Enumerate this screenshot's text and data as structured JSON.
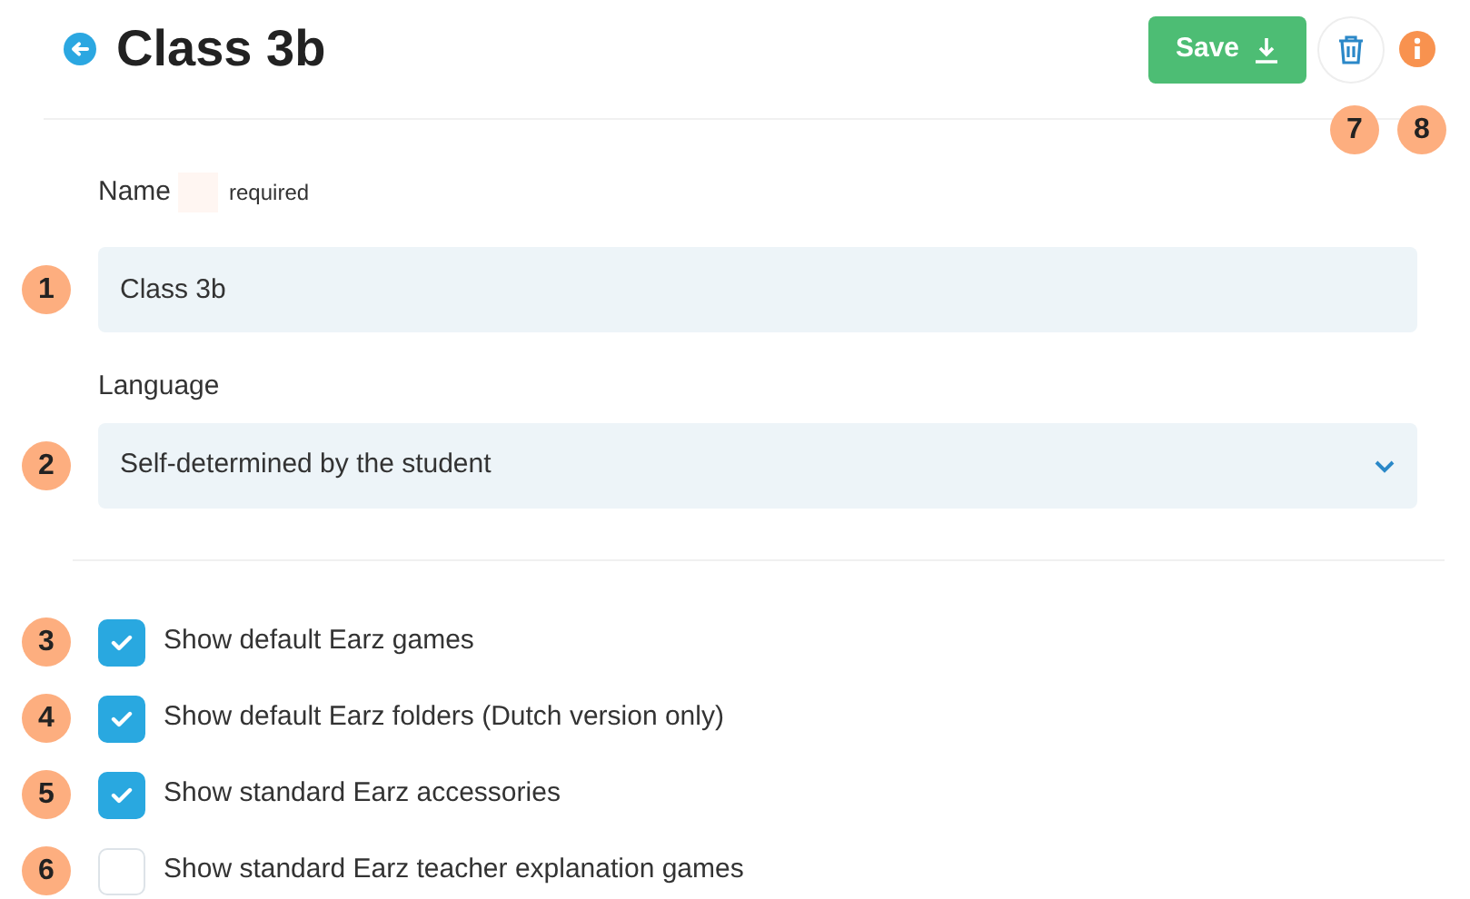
{
  "header": {
    "title": "Class 3b",
    "save_label": "Save"
  },
  "header_badges": [
    "7",
    "8"
  ],
  "name_field": {
    "badge": "1",
    "label": "Name",
    "hint": "required",
    "value": "Class 3b"
  },
  "language_field": {
    "badge": "2",
    "label": "Language",
    "value": "Self-determined by the student"
  },
  "options": [
    {
      "badge": "3",
      "label": "Show default Earz games",
      "checked": true
    },
    {
      "badge": "4",
      "label": "Show default Earz folders (Dutch version only)",
      "checked": true
    },
    {
      "badge": "5",
      "label": "Show standard Earz accessories",
      "checked": true
    },
    {
      "badge": "6",
      "label": "Show standard Earz teacher explanation games",
      "checked": false
    }
  ]
}
